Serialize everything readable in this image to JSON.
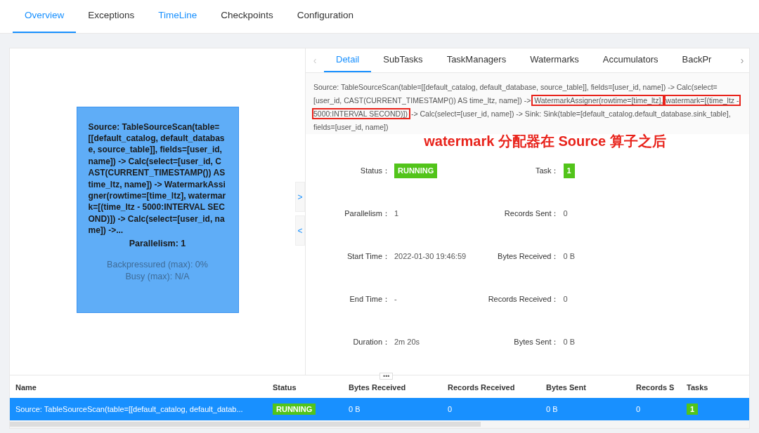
{
  "top_tabs": [
    {
      "label": "Overview",
      "selected": true,
      "hovered": false
    },
    {
      "label": "Exceptions",
      "selected": false,
      "hovered": false
    },
    {
      "label": "TimeLine",
      "selected": false,
      "hovered": true
    },
    {
      "label": "Checkpoints",
      "selected": false,
      "hovered": false
    },
    {
      "label": "Configuration",
      "selected": false,
      "hovered": false
    }
  ],
  "graph": {
    "node": {
      "description": "Source: TableSourceScan(table=[[default_catalog, default_database, source_table]], fields=[user_id, name]) -> Calc(select=[user_id, CAST(CURRENT_TIMESTAMP()) AS time_ltz, name]) -> WatermarkAssigner(rowtime=[time_ltz], watermark=[(time_ltz - 5000:INTERVAL SECOND)]) -> Calc(select=[user_id, name]) ->...",
      "parallelism": "Parallelism: 1",
      "backpressured": "Backpressured (max): 0%",
      "busy": "Busy (max): N/A"
    },
    "side_buttons": [
      {
        "glyph": ">"
      },
      {
        "glyph": "<"
      }
    ]
  },
  "detail_tabs": [
    {
      "label": "Detail",
      "selected": true
    },
    {
      "label": "SubTasks",
      "selected": false
    },
    {
      "label": "TaskManagers",
      "selected": false
    },
    {
      "label": "Watermarks",
      "selected": false
    },
    {
      "label": "Accumulators",
      "selected": false
    },
    {
      "label": "BackPr",
      "selected": false
    }
  ],
  "detail_tab_scroll": {
    "left": "‹",
    "right": "›"
  },
  "resize_handle": "•••",
  "description": [
    {
      "text": "Source: TableSourceScan(table=[[default_catalog, default_database, source_table]], fields=[user_id, name]) -> Calc(select=[user_id, CAST(CURRENT_TIMESTAMP()) AS time_ltz, name]) -> ",
      "highlighted": false
    },
    {
      "text": "WatermarkAssigner(rowtime=[time_ltz],",
      "highlighted": true
    },
    {
      "text": "watermark=[(time_ltz - 5000:INTERVAL SECOND)])",
      "highlighted": true
    },
    {
      "text": " -> Calc(select=[user_id, name]) -> Sink: Sink(table=[default_catalog.default_database.sink_table], fields=[user_id, name])",
      "highlighted": false
    }
  ],
  "annotation": "watermark 分配器在 Source 算子之后",
  "fields": [
    {
      "label": "Status：",
      "value": "RUNNING",
      "kind": "badge"
    },
    {
      "label": "Task：",
      "value": "1",
      "kind": "badge"
    },
    {
      "label": "Parallelism：",
      "value": "1",
      "kind": "text"
    },
    {
      "label": "Records Sent：",
      "value": "0",
      "kind": "text"
    },
    {
      "label": "Start Time：",
      "value": "2022-01-30 19:46:59",
      "kind": "text"
    },
    {
      "label": "Bytes Received：",
      "value": "0 B",
      "kind": "text"
    },
    {
      "label": "End Time：",
      "value": "-",
      "kind": "text"
    },
    {
      "label": "Records Received：",
      "value": "0",
      "kind": "text"
    },
    {
      "label": "Duration：",
      "value": "2m 20s",
      "kind": "text"
    },
    {
      "label": "Bytes Sent：",
      "value": "0 B",
      "kind": "text"
    }
  ],
  "table": {
    "columns": [
      "Name",
      "Status",
      "Bytes Received",
      "Records Received",
      "Bytes Sent",
      "Records S",
      "Tasks"
    ],
    "rows": [
      {
        "selected": true,
        "cells": [
          "Source: TableSourceScan(table=[[default_catalog, default_datab...",
          "RUNNING",
          "0 B",
          "0",
          "0 B",
          "0",
          "1"
        ]
      }
    ]
  }
}
